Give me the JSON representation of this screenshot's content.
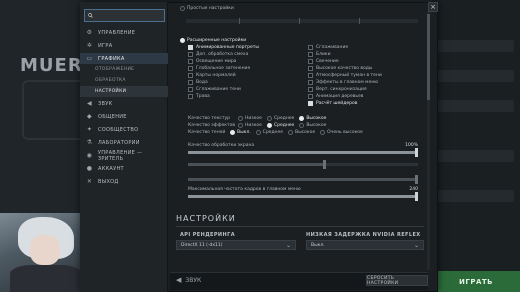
{
  "window": {
    "close_label": "×"
  },
  "search": {
    "placeholder": ""
  },
  "sidebar": {
    "items": [
      {
        "label": "УПРАВЛЕНИЕ",
        "icon": "gamepad-icon"
      },
      {
        "label": "ИГРА",
        "icon": "gear-icon"
      },
      {
        "label": "ГРАФИКА",
        "icon": "monitor-icon"
      },
      {
        "label": "ОТОБРАЖЕНИЕ"
      },
      {
        "label": "ОБРАБОТКА"
      },
      {
        "label": "НАСТРОЙКИ"
      },
      {
        "label": "ЗВУК",
        "icon": "speaker-icon"
      },
      {
        "label": "ОБЩЕНИЕ",
        "icon": "chat-icon"
      },
      {
        "label": "СООБЩЕСТВО",
        "icon": "community-icon"
      },
      {
        "label": "ЛАБОРАТОРИИ",
        "icon": "flask-icon"
      },
      {
        "label": "УПРАВЛЕНИЕ — ЗРИТЕЛЬ",
        "icon": "eye-icon"
      },
      {
        "label": "АККАУНТ",
        "icon": "user-icon"
      },
      {
        "label": "ВЫХОД",
        "icon": "exit-icon"
      }
    ]
  },
  "presets": {
    "label": "Простые настройки"
  },
  "advanced": {
    "label": "Расширенные настройки",
    "col1": [
      {
        "label": "Анимированные портреты",
        "checked": true
      },
      {
        "label": "Доп. обработка смеха",
        "checked": false
      },
      {
        "label": "Освещение мира",
        "checked": false
      },
      {
        "label": "Глобальное затенение",
        "checked": false
      },
      {
        "label": "Карты нормалей",
        "checked": false
      },
      {
        "label": "Вода",
        "checked": false
      },
      {
        "label": "Сглаживание тени",
        "checked": false
      },
      {
        "label": "Трава",
        "checked": false
      }
    ],
    "col2": [
      {
        "label": "Сглаживание",
        "checked": false
      },
      {
        "label": "Блики",
        "checked": false
      },
      {
        "label": "Свечение",
        "checked": false
      },
      {
        "label": "Высокое качество воды",
        "checked": false
      },
      {
        "label": "Атмосферный туман в тени",
        "checked": false
      },
      {
        "label": "Эффекты в главном меню",
        "checked": false
      },
      {
        "label": "Верт. синхронизация",
        "checked": false
      },
      {
        "label": "Анимация деревьев",
        "checked": false
      },
      {
        "label": "Расчёт шейдеров",
        "checked": true
      }
    ]
  },
  "quality": {
    "texture": {
      "label": "Качество текстур",
      "options": [
        "Низкое",
        "Среднее",
        "Высокое"
      ],
      "selected": 2
    },
    "effects": {
      "label": "Качество эффектов",
      "options": [
        "Низкое",
        "Среднее",
        "Высокое"
      ],
      "selected": 1
    },
    "shadows": {
      "label": "Качество теней",
      "options": [
        "Выкл.",
        "Среднее",
        "Высокое",
        "Очень высокое"
      ],
      "selected": 0
    }
  },
  "sliders": {
    "render": {
      "label": "Качество обработки экрана",
      "value": "100%",
      "level": 1.0
    },
    "s2": {
      "label": "",
      "value": "",
      "level": 0.6
    },
    "s3": {
      "label": "",
      "value": "",
      "level": 1.0
    },
    "fps": {
      "label": "Максимальная частота кадров в главном меню",
      "value": "240",
      "level": 1.0
    }
  },
  "settings": {
    "title": "НАСТРОЙКИ",
    "api": {
      "label": "API РЕНДЕРИНГА",
      "value": "DirectX 11 (-dx11)"
    },
    "reflex": {
      "label": "НИЗКАЯ ЗАДЕРЖКА NVIDIA REFLEX",
      "value": "Выкл."
    }
  },
  "footer": {
    "sound_label": "ЗВУК",
    "reset_label": "СБРОСИТЬ НАСТРОЙКИ"
  },
  "background": {
    "hero_name": "MUERTA",
    "play_label": "ИГРАТЬ"
  }
}
